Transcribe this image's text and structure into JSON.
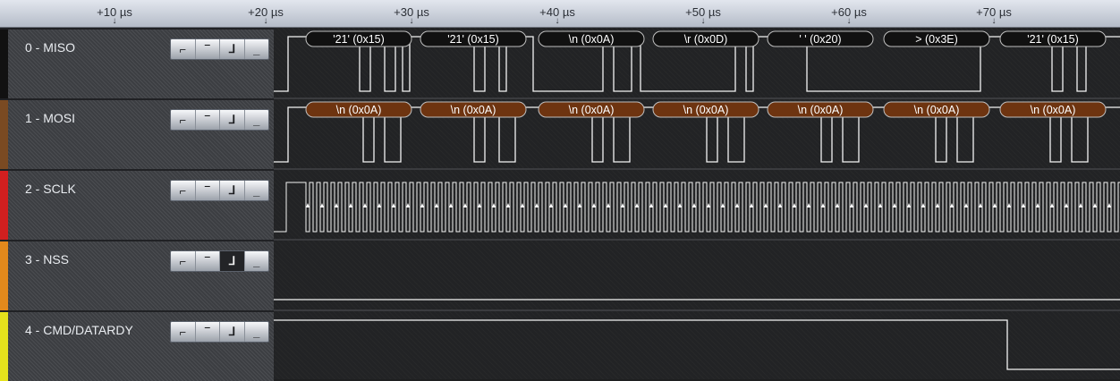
{
  "ruler": {
    "ticks": [
      "+10 µs",
      "+20 µs",
      "+30 µs",
      "+40 µs",
      "+50 µs",
      "+60 µs",
      "+70 µs"
    ]
  },
  "channels": [
    {
      "label": "0 - MISO",
      "color": "#111111",
      "trigger_active": null
    },
    {
      "label": "1 - MOSI",
      "color": "#7a4a22",
      "trigger_active": null
    },
    {
      "label": "2 - SCLK",
      "color": "#d11f1f",
      "trigger_active": null
    },
    {
      "label": "3 - NSS",
      "color": "#e2891c",
      "trigger_active": "falling"
    },
    {
      "label": "4 - CMD/DATARDY",
      "color": "#e5e21c",
      "trigger_active": null
    }
  ],
  "trigger_buttons": [
    "rising-edge",
    "high-level",
    "falling-edge",
    "low-level"
  ],
  "decoded": {
    "miso": [
      "'21' (0x15)",
      "'21' (0x15)",
      "\\n (0x0A)",
      "\\r (0x0D)",
      "' ' (0x20)",
      "> (0x3E)",
      "'21' (0x15)"
    ],
    "mosi": [
      "\\n (0x0A)",
      "\\n (0x0A)",
      "\\n (0x0A)",
      "\\n (0x0A)",
      "\\n (0x0A)",
      "\\n (0x0A)",
      "\\n (0x0A)"
    ]
  },
  "colors": {
    "miso_bubble": "#111111",
    "mosi_bubble": "#6e3410",
    "trace": "#f4f4f4"
  }
}
